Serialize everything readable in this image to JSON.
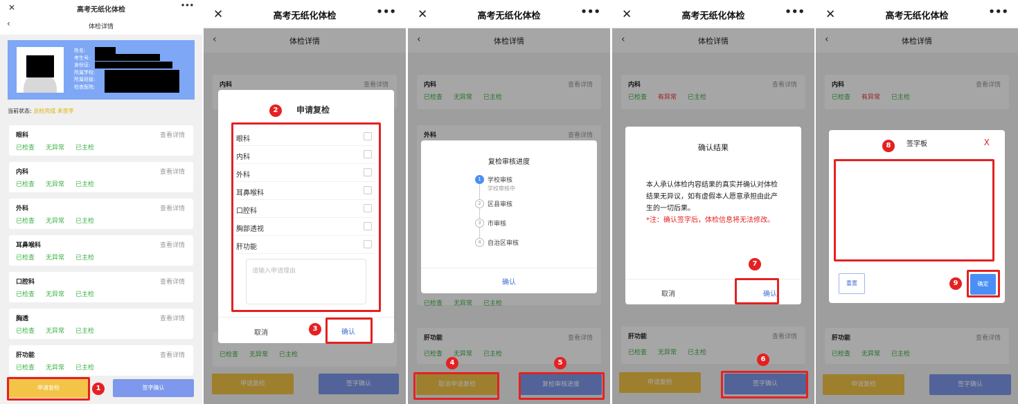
{
  "app": {
    "title": "高考无纸化体检",
    "close": "✕",
    "more": "•••",
    "back": "‹",
    "subtitle": "体检详情"
  },
  "profile": {
    "fields": [
      "姓名:",
      "考生号:",
      "身份证:",
      "所属学校:",
      "所属班级:",
      "检查医院:"
    ]
  },
  "status": {
    "label": "当前状态:",
    "value": "总检完成 未签字"
  },
  "sections": [
    {
      "name": "眼科",
      "detail": "查看详情",
      "checked": "已检查",
      "result": "无异常",
      "doctor": "已主检"
    },
    {
      "name": "内科",
      "detail": "查看详情",
      "checked": "已检查",
      "result": "无异常",
      "doctor": "已主检"
    },
    {
      "name": "外科",
      "detail": "查看详情",
      "checked": "已检查",
      "result": "无异常",
      "doctor": "已主检"
    },
    {
      "name": "耳鼻喉科",
      "detail": "查看详情",
      "checked": "已检查",
      "result": "无异常",
      "doctor": "已主检"
    },
    {
      "name": "口腔科",
      "detail": "查看详情",
      "checked": "已检查",
      "result": "无异常",
      "doctor": "已主检"
    },
    {
      "name": "胸透",
      "detail": "查看详情",
      "checked": "已检查",
      "result": "无异常",
      "doctor": "已主检"
    },
    {
      "name": "肝功能",
      "detail": "查看详情",
      "checked": "已检查",
      "result": "无异常",
      "doctor": "已主检"
    }
  ],
  "abnormal": "有异常",
  "buttons": {
    "apply": "申请复检",
    "sign": "签字确认",
    "cancel_apply": "取消申请复检",
    "progress": "复检审核进度"
  },
  "recheck_modal": {
    "title": "申请复检",
    "items": [
      "眼科",
      "内科",
      "外科",
      "耳鼻喉科",
      "口腔科",
      "胸部透视",
      "肝功能"
    ],
    "placeholder": "请输入申请理由",
    "cancel": "取消",
    "confirm": "确认"
  },
  "progress_modal": {
    "title": "复检审核进度",
    "steps": [
      {
        "n": "1",
        "label": "学校审核",
        "sub": "学校审核中"
      },
      {
        "n": "2",
        "label": "区县审核"
      },
      {
        "n": "3",
        "label": "市审核"
      },
      {
        "n": "4",
        "label": "自治区审核"
      }
    ],
    "confirm": "确认"
  },
  "confirm_modal": {
    "title": "确认结果",
    "body": "本人承认体检内容结果的真实并确认对体检结果无异议，如有虚假本人愿意承担由此产生的一切后果。",
    "note": "*注：确认签字后，体检信息将无法修改。",
    "cancel": "取消",
    "confirm": "确认"
  },
  "sign_modal": {
    "title": "签字板",
    "close": "X",
    "reset": "重置",
    "ok": "确定"
  },
  "markers": [
    "1",
    "2",
    "3",
    "4",
    "5",
    "6",
    "7",
    "8",
    "9"
  ],
  "colors": {
    "green": "#3cb043",
    "red": "#e42121",
    "yellow": "#f3c447",
    "blue": "#7d98ec",
    "link": "#3d6fd6"
  }
}
